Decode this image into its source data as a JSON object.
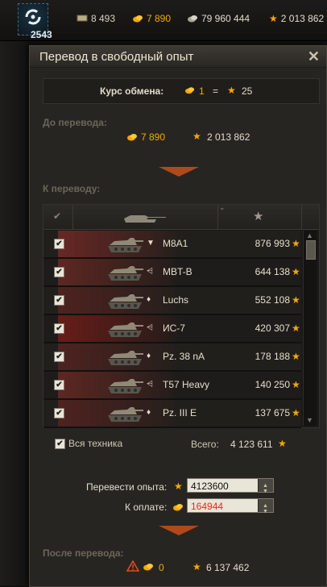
{
  "topbar": {
    "free_xp_value": "2543",
    "bonds": "8 493",
    "gold": "7 890",
    "credits": "79 960 444",
    "xp_total": "2 013 862"
  },
  "window": {
    "title": "Перевод в свободный опыт",
    "close_symbol": "✕",
    "rate_label": "Курс обмена:",
    "rate_gold": "1",
    "rate_eq": "=",
    "rate_xp": "25",
    "before_label": "До перевода:",
    "before_gold": "7 890",
    "before_xp": "2 013 862",
    "to_convert_label": "К переводу:",
    "vehicles": [
      {
        "tier": "▼",
        "name": "M8A1",
        "xp": "876 993",
        "flag": "#7a2a26"
      },
      {
        "tier": "⩤",
        "name": "MBT-B",
        "xp": "644 138",
        "flag": "#6e2a24"
      },
      {
        "tier": "♦",
        "name": "Luchs",
        "xp": "552 108",
        "flag": "#5a2320"
      },
      {
        "tier": "⩤",
        "name": "ИС-7",
        "xp": "420 307",
        "flag": "#7b1d16"
      },
      {
        "tier": "♦",
        "name": "Pz. 38 nA",
        "xp": "178 188",
        "flag": "#5a2320"
      },
      {
        "tier": "⩤",
        "name": "T57 Heavy",
        "xp": "140 250",
        "flag": "#6e2a24"
      },
      {
        "tier": "♦",
        "name": "Pz. III E",
        "xp": "137 675",
        "flag": "#5a2320"
      }
    ],
    "all_vehicles_label": "Вся техника",
    "total_label": "Всего:",
    "total_value": "4 123 611",
    "convert_label": "Перевести опыта:",
    "convert_value": "4123600",
    "pay_label": "К оплате:",
    "pay_value": "164944",
    "after_label": "После перевода:",
    "after_gold": "0",
    "after_xp": "6 137 462",
    "colors": {
      "gold": "#f6a800",
      "pay_red": "#e52a1a",
      "accent": "#c8501a"
    }
  }
}
